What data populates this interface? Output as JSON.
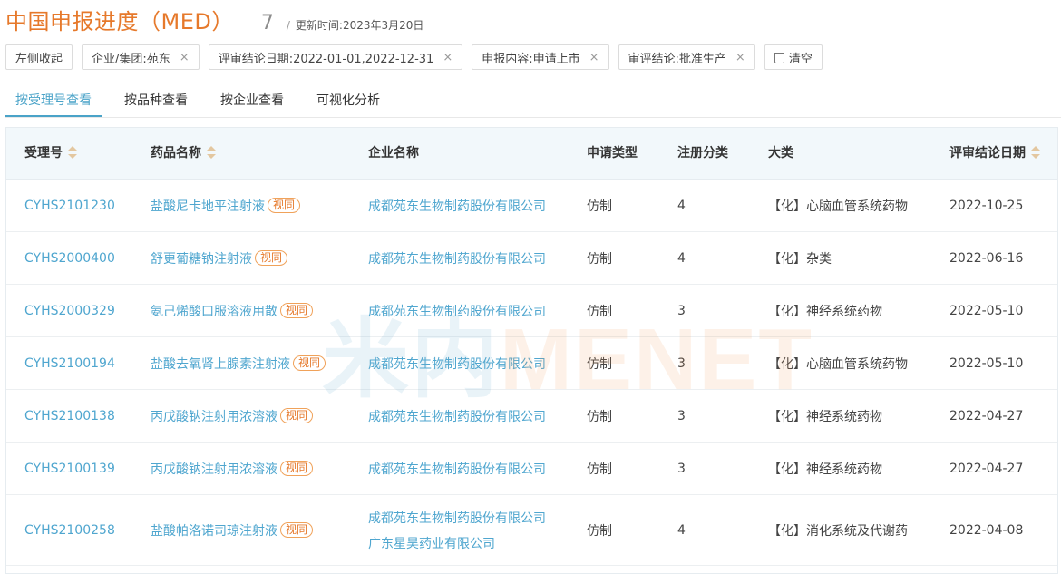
{
  "header": {
    "title": "中国申报进度（MED）",
    "count": "7",
    "separator": "/",
    "update_label": "更新时间:",
    "update_value": "2023年3月20日"
  },
  "filters": {
    "collapse_label": "左侧收起",
    "chips": [
      "企业/集团:苑东",
      "评审结论日期:2022-01-01,2022-12-31",
      "申报内容:申请上市",
      "审评结论:批准生产"
    ],
    "remove_glyph": "×",
    "clear_label": "清空"
  },
  "tabs": [
    {
      "label": "按受理号查看",
      "active": true
    },
    {
      "label": "按品种查看",
      "active": false
    },
    {
      "label": "按企业查看",
      "active": false
    },
    {
      "label": "可视化分析",
      "active": false
    }
  ],
  "table": {
    "columns": [
      "受理号",
      "药品名称",
      "企业名称",
      "申请类型",
      "注册分类",
      "大类",
      "评审结论日期"
    ],
    "badge": "视同",
    "rows": [
      {
        "acceptance_no": "CYHS2101230",
        "drug": "盐酸尼卡地平注射液",
        "company": [
          "成都苑东生物制药股份有限公司"
        ],
        "app_type": "仿制",
        "reg_class": "4",
        "category": "【化】心脑血管系统药物",
        "date": "2022-10-25"
      },
      {
        "acceptance_no": "CYHS2000400",
        "drug": "舒更葡糖钠注射液",
        "company": [
          "成都苑东生物制药股份有限公司"
        ],
        "app_type": "仿制",
        "reg_class": "4",
        "category": "【化】杂类",
        "date": "2022-06-16"
      },
      {
        "acceptance_no": "CYHS2000329",
        "drug": "氨己烯酸口服溶液用散",
        "company": [
          "成都苑东生物制药股份有限公司"
        ],
        "app_type": "仿制",
        "reg_class": "3",
        "category": "【化】神经系统药物",
        "date": "2022-05-10"
      },
      {
        "acceptance_no": "CYHS2100194",
        "drug": "盐酸去氧肾上腺素注射液",
        "company": [
          "成都苑东生物制药股份有限公司"
        ],
        "app_type": "仿制",
        "reg_class": "3",
        "category": "【化】心脑血管系统药物",
        "date": "2022-05-10"
      },
      {
        "acceptance_no": "CYHS2100138",
        "drug": "丙戊酸钠注射用浓溶液",
        "company": [
          "成都苑东生物制药股份有限公司"
        ],
        "app_type": "仿制",
        "reg_class": "3",
        "category": "【化】神经系统药物",
        "date": "2022-04-27"
      },
      {
        "acceptance_no": "CYHS2100139",
        "drug": "丙戊酸钠注射用浓溶液",
        "company": [
          "成都苑东生物制药股份有限公司"
        ],
        "app_type": "仿制",
        "reg_class": "3",
        "category": "【化】神经系统药物",
        "date": "2022-04-27"
      },
      {
        "acceptance_no": "CYHS2100258",
        "drug": "盐酸帕洛诺司琼注射液",
        "company": [
          "成都苑东生物制药股份有限公司",
          "广东星昊药业有限公司"
        ],
        "app_type": "仿制",
        "reg_class": "4",
        "category": "【化】消化系统及代谢药",
        "date": "2022-04-08"
      }
    ]
  },
  "watermark": {
    "part_a": "米内",
    "part_b": "MENET"
  },
  "colors": {
    "accent_orange": "#e6792b",
    "link_blue": "#4fa6cf",
    "header_bg": "#f2f8fb"
  }
}
